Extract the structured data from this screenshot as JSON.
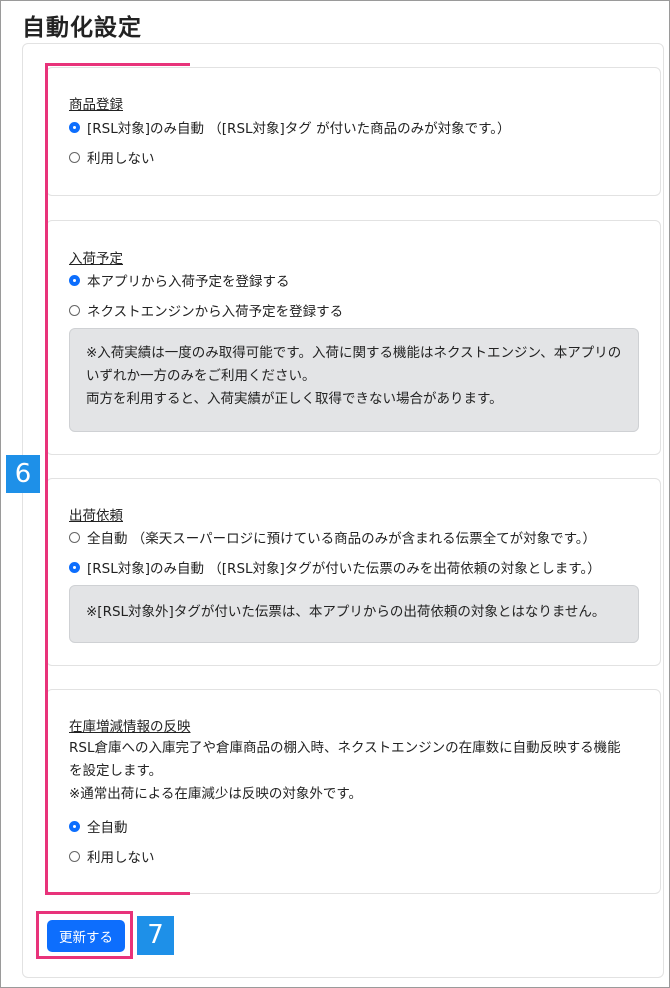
{
  "page": {
    "title": "自動化設定"
  },
  "markers": {
    "step6": "6",
    "step7": "7"
  },
  "sections": {
    "product": {
      "title": "商品登録",
      "options": [
        {
          "label": "[RSL対象]のみ自動 （[RSL対象]タグ が付いた商品のみが対象です。）",
          "checked": true
        },
        {
          "label": "利用しない",
          "checked": false
        }
      ]
    },
    "arrival": {
      "title": "入荷予定",
      "options": [
        {
          "label": "本アプリから入荷予定を登録する",
          "checked": true
        },
        {
          "label": "ネクストエンジンから入荷予定を登録する",
          "checked": false
        }
      ],
      "note": [
        "※入荷実績は一度のみ取得可能です。入荷に関する機能はネクストエンジン、本アプリの",
        "いずれか一方のみをご利用ください。",
        "両方を利用すると、入荷実績が正しく取得できない場合があります。"
      ]
    },
    "shipping": {
      "title": "出荷依頼",
      "options": [
        {
          "label": "全自動 （楽天スーパーロジに預けている商品のみが含まれる伝票全てが対象です。）",
          "checked": false
        },
        {
          "label": "[RSL対象]のみ自動 （[RSL対象]タグが付いた伝票のみを出荷依頼の対象とします。）",
          "checked": true
        }
      ],
      "note": "※[RSL対象外]タグが付いた伝票は、本アプリからの出荷依頼の対象とはなりません。"
    },
    "inventory": {
      "title": "在庫増減情報の反映",
      "description": [
        "RSL倉庫への入庫完了や倉庫商品の棚入時、ネクストエンジンの在庫数に自動反映する機能",
        "を設定します。",
        "※通常出荷による在庫減少は反映の対象外です。"
      ],
      "options": [
        {
          "label": "全自動",
          "checked": true
        },
        {
          "label": "利用しない",
          "checked": false
        }
      ]
    }
  },
  "actions": {
    "update_label": "更新する"
  },
  "colors": {
    "accent_pink": "#e8337a",
    "marker_blue": "#1e90e8",
    "button_blue": "#0d6efd"
  }
}
